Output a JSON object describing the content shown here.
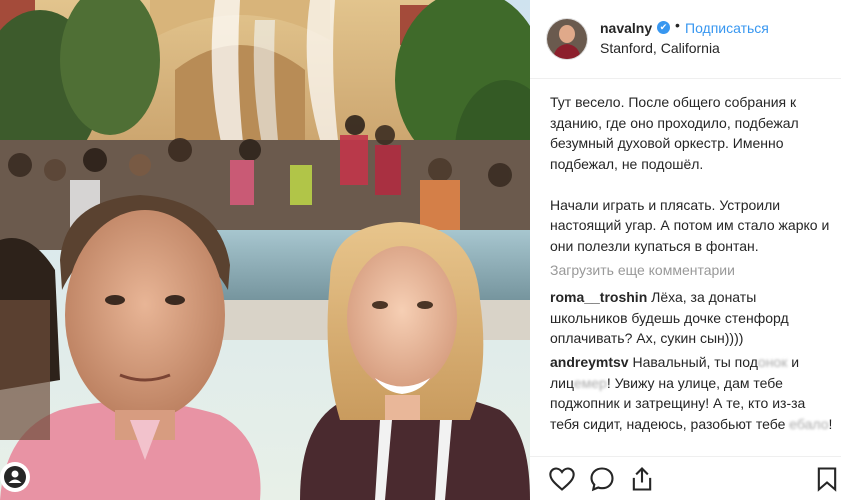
{
  "header": {
    "username": "navalny",
    "verified_icon": "verified-badge-icon",
    "separator": "•",
    "follow_label": "Подписаться",
    "location": "Stanford, California"
  },
  "caption": {
    "text": "Тут весело. После общего собрания к зданию, где оно проходило, подбежал безумный духовой оркестр. Именно подбежал, не подошёл.\n\nНачали играть и плясать. Устроили настоящий угар. А потом им стало жарко и они полезли купаться в фонтан."
  },
  "load_more_label": "Загрузить еще комментарии",
  "comments": [
    {
      "user": "roma__troshin",
      "text": "Лёха, за донаты школьников будешь дочке стенфорд оплачивать? Ах, сукин сын))))"
    },
    {
      "user": "andreymtsv",
      "text_part1": "Навальный, ты под",
      "blur1": "онок",
      "text_part2": " и лиц",
      "blur2": "емер",
      "text_part3": "! Увижу на улице, дам тебе поджопник и затрещину! А те, кто из-за тебя сидит, надеюсь, разобьют тебе ",
      "blur3": "ебало",
      "text_part4": "!"
    }
  ],
  "actions": {
    "like_icon": "heart-icon",
    "comment_icon": "comment-bubble-icon",
    "share_icon": "share-icon",
    "save_icon": "bookmark-icon"
  },
  "colors": {
    "accent": "#3897f0",
    "text": "#262626",
    "muted": "#999999",
    "divider": "#efefef"
  }
}
